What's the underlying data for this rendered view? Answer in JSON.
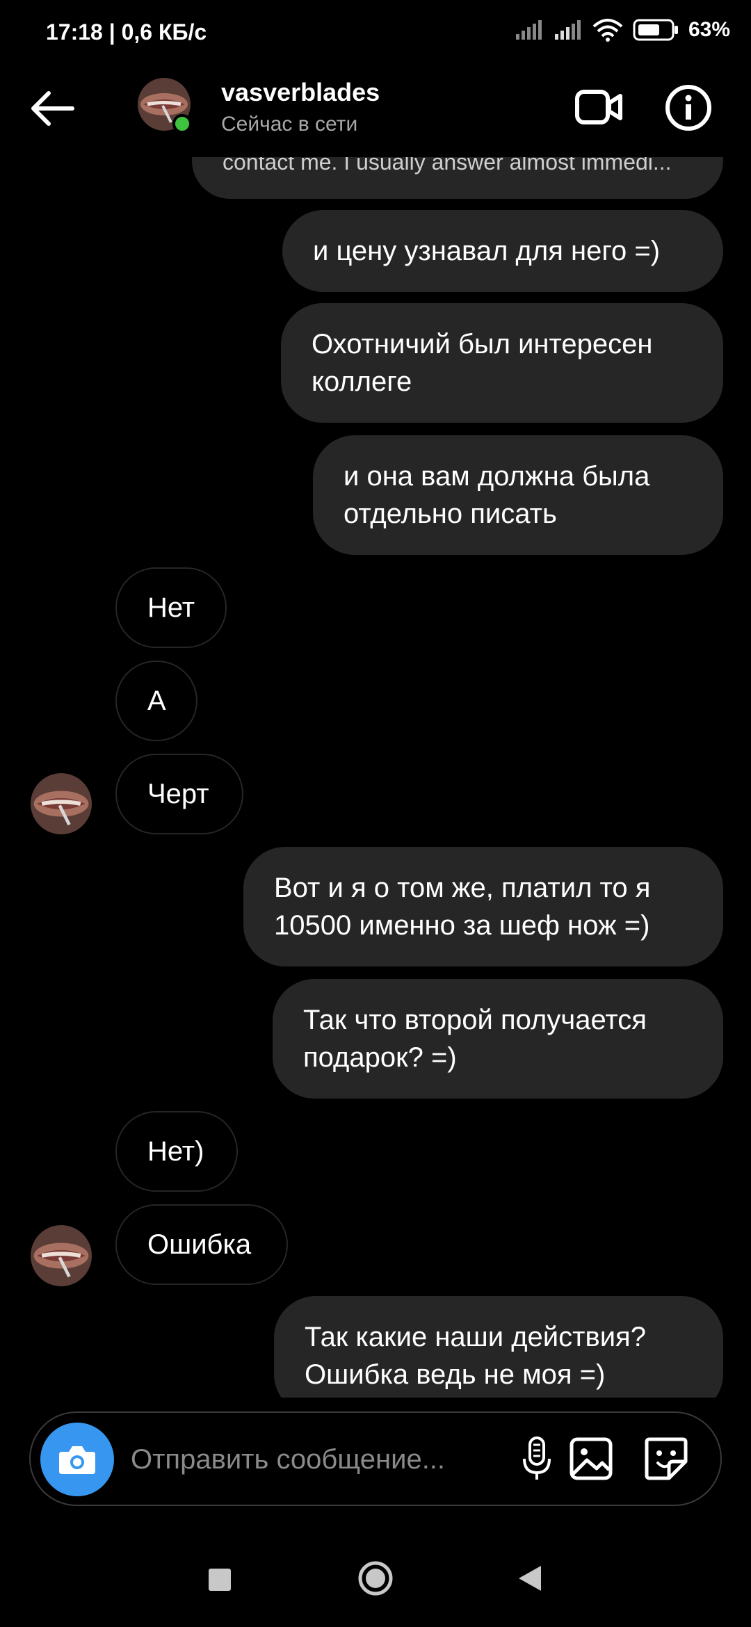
{
  "status_bar": {
    "time": "17:18 | 0,6 КБ/с",
    "battery": "63%",
    "icons": [
      "signal-icon",
      "signal-icon",
      "wifi-icon",
      "battery-icon"
    ]
  },
  "header": {
    "username": "vasverblades",
    "status": "Сейчас в сети",
    "icons": [
      "back-arrow-icon",
      "video-call-icon",
      "info-icon"
    ]
  },
  "messages": [
    {
      "direction": "in",
      "text": "contact me. I usually answer almost immedi..."
    },
    {
      "direction": "out",
      "text": "и цену узнавал для него =)"
    },
    {
      "direction": "out",
      "text": "Охотничий был интересен\nколлеге"
    },
    {
      "direction": "out",
      "text": "и она вам должна была\nотдельно писать"
    },
    {
      "direction": "in",
      "text": "Нет"
    },
    {
      "direction": "in",
      "text": "А"
    },
    {
      "direction": "in",
      "text": "Черт"
    },
    {
      "direction": "out",
      "text": "Вот и я о том же, платил то я\n10500 именно за шеф нож =)"
    },
    {
      "direction": "out",
      "text": "Так что второй получается\nподарок? =)"
    },
    {
      "direction": "in",
      "text": "Нет)"
    },
    {
      "direction": "in",
      "text": "Ошибка"
    },
    {
      "direction": "out",
      "text": "Так какие наши действия?\nОшибка ведь не моя =)"
    }
  ],
  "composer": {
    "placeholder": "Отправить сообщение...",
    "icons": [
      "camera-icon",
      "microphone-icon",
      "gallery-icon",
      "sticker-icon"
    ]
  },
  "navbar": {
    "icons": [
      "recents-square-icon",
      "home-circle-icon",
      "back-triangle-icon"
    ]
  },
  "colors": {
    "background": "#000000",
    "outgoing_bubble": "#262626",
    "incoming_border": "#262626",
    "online": "#3fc23f",
    "camera_button": "#3797f0",
    "secondary_text": "#a8a8a8"
  }
}
